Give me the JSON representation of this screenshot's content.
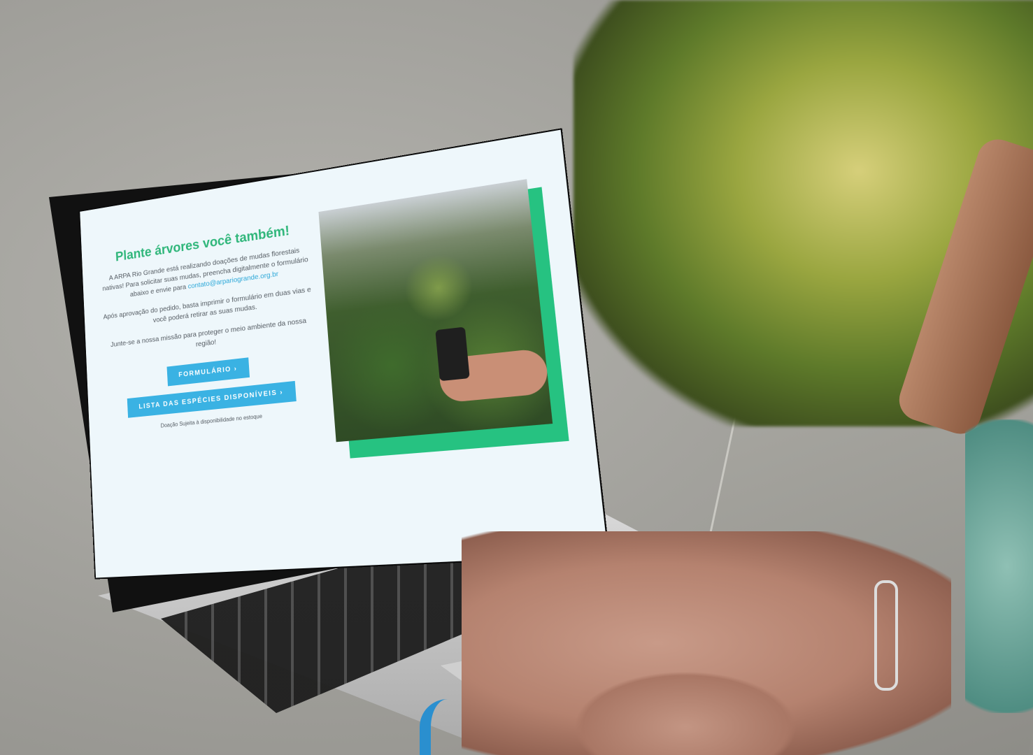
{
  "page": {
    "title": "Plante árvores você também!",
    "intro_text": "A ARPA Rio Grande está realizando doações de mudas florestais nativas! Para solicitar suas mudas, preencha digitalmente o formulário abaixo e envie para",
    "email": "contato@arpariogrande.org.br",
    "approval_text": "Após aprovação do pedido, basta imprimir o formulário em duas vias e você poderá retirar as suas mudas.",
    "mission_text": "Junte-se a nossa missão para proteger o meio ambiente da nossa região!",
    "form_button": "FORMULÁRIO",
    "species_button": "LISTA DAS ESPÉCIES DISPONÍVEIS",
    "button_arrow": "›",
    "footnote": "Doação Sujeita à disponibilidade no estoque"
  },
  "colors": {
    "title_green": "#2fb67a",
    "accent_green": "#26c281",
    "button_blue": "#3ab2e3",
    "link_blue": "#2aa7d8",
    "page_bg": "#eef7fb"
  }
}
